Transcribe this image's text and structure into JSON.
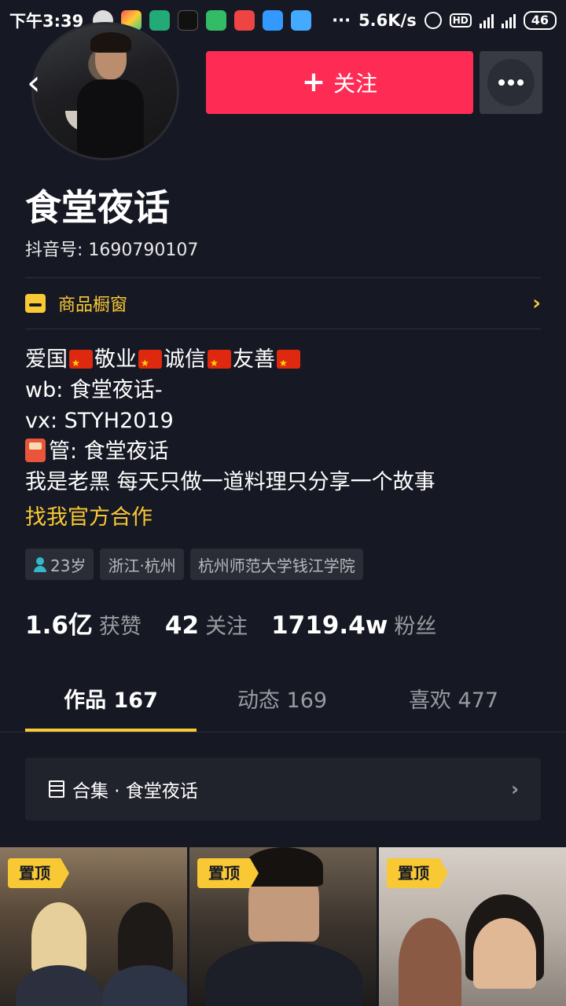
{
  "status_bar": {
    "time": "下午3:39",
    "dots": "···",
    "net_speed": "5.6K/s",
    "hd": "HD",
    "battery": "46"
  },
  "header": {
    "follow_label": "关注",
    "follow_plus": "+"
  },
  "profile": {
    "name": "食堂夜话",
    "douyin_id": "抖音号: 1690790107",
    "shop_label": "商品橱窗",
    "bio": {
      "line1_parts": [
        "爱国",
        "敬业",
        "诚信",
        "友善"
      ],
      "line2": "wb: 食堂夜话-",
      "line3": "vx: STYH2019",
      "line4": "管: 食堂夜话",
      "line5": "我是老黑 每天只做一道料理只分享一个故事"
    },
    "collab_link": "找我官方合作",
    "tags": [
      "23岁",
      "浙江·杭州",
      "杭州师范大学钱江学院"
    ]
  },
  "stats": {
    "likes_value": "1.6亿",
    "likes_label": "获赞",
    "following_value": "42",
    "following_label": "关注",
    "followers_value": "1719.4w",
    "followers_label": "粉丝"
  },
  "tabs": [
    {
      "label": "作品 167",
      "active": true
    },
    {
      "label": "动态 169",
      "active": false
    },
    {
      "label": "喜欢 477",
      "active": false
    }
  ],
  "collection": {
    "label": "合集 · 食堂夜话"
  },
  "videos": [
    {
      "pin_label": "置顶"
    },
    {
      "pin_label": "置顶"
    },
    {
      "pin_label": "置顶"
    }
  ],
  "colors": {
    "background": "#161823",
    "follow_button": "#fe2c55",
    "accent_yellow": "#f8c935"
  }
}
